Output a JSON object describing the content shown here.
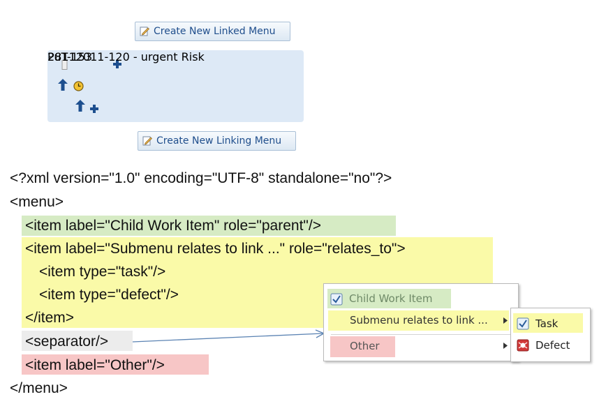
{
  "top_button": {
    "label": "Create New Linked Menu"
  },
  "bottom_button": {
    "label": "Create New Linking Menu"
  },
  "card": {
    "id_label": "PuT-153",
    "title": "28112011-120 - urgent Risk"
  },
  "xml": {
    "line1": "<?xml version=\"1.0\" encoding=\"UTF-8\" standalone=\"no\"?>",
    "line2": "<menu>",
    "line3": "<item label=\"Child Work Item\" role=\"parent\"/>",
    "line4": "<item label=\"Submenu relates to link ...\" role=\"relates_to\">",
    "line5": "<item type=\"task\"/>",
    "line6": "<item type=\"defect\"/>",
    "line7": "</item>",
    "line8": "<separator/>",
    "line9": "<item label=\"Other\"/>",
    "line10": "</menu>"
  },
  "context_menu": {
    "child_item": "Child Work Item",
    "submenu_item": "Submenu relates to link ...",
    "other_item": "Other"
  },
  "submenu": {
    "task": "Task",
    "defect": "Defect"
  },
  "colors": {
    "green_highlight": "#d6ebc4",
    "yellow_highlight": "#fafaa8",
    "gray_highlight": "#ececec",
    "pink_highlight": "#f7c6c6"
  },
  "icons": [
    "pencil-edit-icon",
    "bookmark-icon",
    "plus-icon",
    "up-arrow-icon",
    "clock-icon",
    "checkbox-icon",
    "defect-icon",
    "chevron-right-icon"
  ]
}
